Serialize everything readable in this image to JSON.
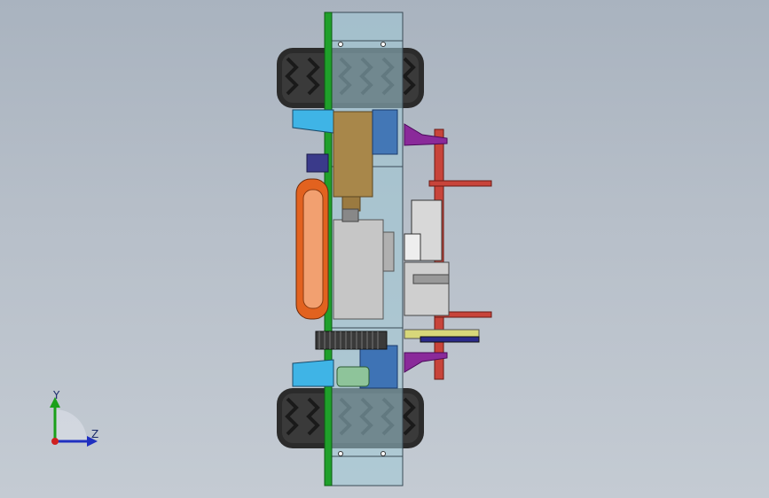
{
  "viewport": {
    "background_top": "#a9b3bf",
    "background_bottom": "#c4cbd3"
  },
  "model": {
    "frame_color": "#9fc9d6",
    "tire_color": "#2a2a2a",
    "green_plate_color": "#1fa02a",
    "red_rod_color": "#c8443a",
    "purple_bracket_color": "#8a2a9a",
    "orange_wheel_color": "#e2621f",
    "motor_color": "#c6c6c6",
    "gear_color": "#3a3a3a",
    "battery_color": "#a8874a",
    "blue_part_color": "#2a64b0",
    "cyan_part_color": "#3fb4e6"
  },
  "triad": {
    "y_label": "Y",
    "z_label": "Z",
    "y_color": "#1aa01a",
    "z_color": "#2030c0",
    "x_color": "#d02020"
  }
}
